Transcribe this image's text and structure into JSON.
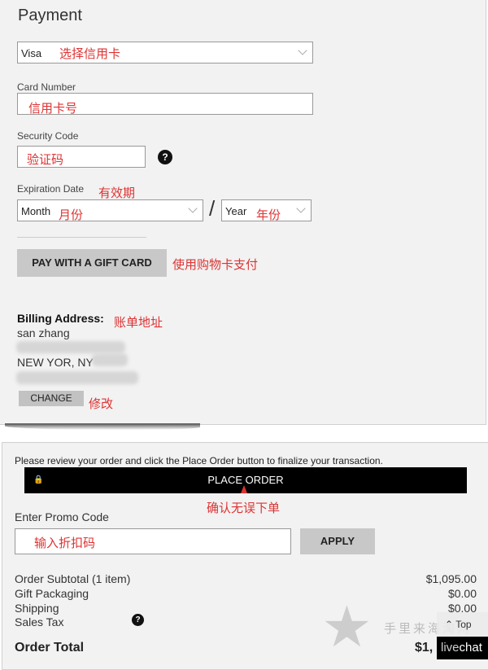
{
  "payment": {
    "title": "Payment",
    "card_type": "Visa",
    "card_type_note": "选择信用卡",
    "card_number_label": "Card Number",
    "card_number_note": "信用卡号",
    "security_code_label": "Security Code",
    "security_code_note": "验证码",
    "expiration_label": "Expiration Date",
    "expiration_note": "有效期",
    "month": "Month",
    "month_note": "月份",
    "slash": "/",
    "year": "Year",
    "year_note": "年份",
    "gift_card_button": "PAY WITH A GIFT CARD",
    "gift_card_note": "使用购物卡支付"
  },
  "billing": {
    "label": "Billing Address:",
    "note": "账单地址",
    "name": "san zhang",
    "city": "NEW YOR, NY",
    "change_button": "CHANGE",
    "change_note": "修改"
  },
  "order": {
    "review_text": "Please review your order and click the Place Order button to finalize your transaction.",
    "place_order": "PLACE ORDER",
    "place_order_note": "确认无误下单",
    "promo_label": "Enter Promo Code",
    "promo_note": "输入折扣码",
    "apply": "APPLY",
    "summary": [
      {
        "label": "Order Subtotal (1 item)",
        "value": "$1,095.00"
      },
      {
        "label": "Gift Packaging",
        "value": "$0.00"
      },
      {
        "label": "Shipping",
        "value": "$0.00"
      },
      {
        "label": "Sales Tax",
        "value": ""
      }
    ],
    "total_label": "Order Total",
    "total_value": "$1,"
  },
  "widgets": {
    "top": "Top",
    "livechat_a": "live",
    "livechat_b": "chat",
    "watermark": "手里来海淘网"
  }
}
